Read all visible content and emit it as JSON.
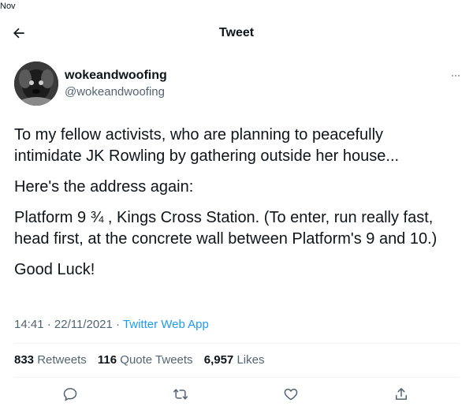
{
  "status_bar": {
    "text": "Nov"
  },
  "header": {
    "title": "Tweet",
    "back_icon": "arrow-left-icon"
  },
  "author": {
    "display_name": "wokeandwoofing",
    "handle": "@wokeandwoofing",
    "more_icon": "more-horizontal-icon"
  },
  "tweet": {
    "paragraphs": [
      "To my fellow activists, who are planning to peacefully intimidate JK Rowling by gathering outside her house...",
      "Here's the address again:",
      "Platform 9 ¾ , Kings Cross Station. (To enter, run really fast, head first, at the concrete wall between Platform's 9 and 10.)",
      "Good Luck!"
    ],
    "time": "14:41",
    "separator": " · ",
    "date": "22/11/2021",
    "source": "Twitter Web App"
  },
  "stats": {
    "retweets_count": "833",
    "retweets_label": "Retweets",
    "quote_count": "116",
    "quote_label": "Quote Tweets",
    "likes_count": "6,957",
    "likes_label": "Likes"
  },
  "actions": {
    "reply_icon": "reply-icon",
    "retweet_icon": "retweet-icon",
    "like_icon": "like-icon",
    "share_icon": "share-icon"
  },
  "colors": {
    "link": "#1d9bf0",
    "secondary_text": "#536471",
    "primary_text": "#0f1419",
    "divider": "#eff3f4"
  }
}
